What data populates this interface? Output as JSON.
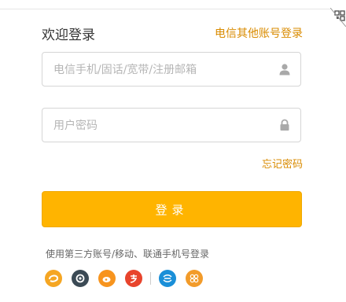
{
  "header": {
    "welcome": "欢迎登录",
    "other_login": "电信其他账号登录"
  },
  "form": {
    "account_placeholder": "电信手机/固话/宽带/注册邮箱",
    "account_value": "",
    "password_placeholder": "用户密码",
    "password_value": "",
    "forgot": "忘记密码",
    "submit": "登录"
  },
  "third_party": {
    "label": "使用第三方账号/移动、联通手机号登录",
    "icons": [
      "tianyi-icon",
      "netease-icon",
      "weibo-icon",
      "alipay-icon",
      "china-mobile-icon",
      "china-unicom-icon"
    ]
  },
  "colors": {
    "accent": "#ffb400",
    "link": "#d98b00",
    "border": "#d5d5d5"
  }
}
